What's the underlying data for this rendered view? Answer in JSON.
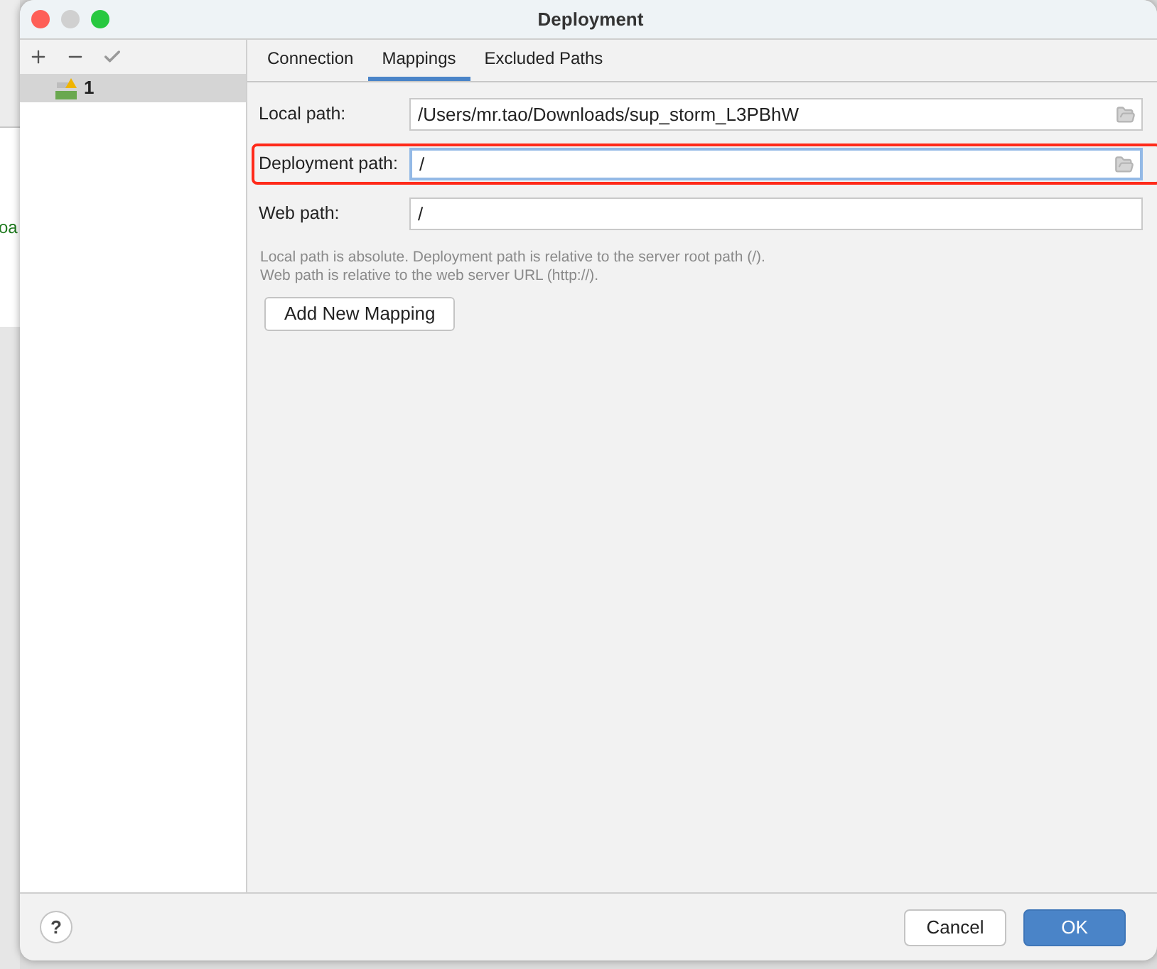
{
  "background": {
    "text": "oa"
  },
  "window": {
    "title": "Deployment"
  },
  "toolbar": [
    {
      "kind": "add",
      "disabled": false
    },
    {
      "kind": "remove",
      "disabled": false
    },
    {
      "kind": "check",
      "disabled": true
    }
  ],
  "servers": [
    {
      "name": "1",
      "selected": true,
      "warning": true
    }
  ],
  "tabs": [
    {
      "label": "Connection",
      "selected": false
    },
    {
      "label": "Mappings",
      "selected": true
    },
    {
      "label": "Excluded Paths",
      "selected": false
    }
  ],
  "fields": [
    {
      "label": "Local path:",
      "value": "/Users/mr.tao/Downloads/sup_storm_L3PBhW",
      "focused": false,
      "browse": true,
      "highlighted": false
    },
    {
      "label": "Deployment path:",
      "value": "/",
      "focused": true,
      "browse": true,
      "highlighted": true
    },
    {
      "label": "Web path:",
      "value": "/",
      "focused": false,
      "browse": false,
      "highlighted": false
    }
  ],
  "hint": [
    "Local path is absolute. Deployment path is relative to the server root path (/).",
    "Web path is relative to the web server URL (http://)."
  ],
  "add_button": "Add New Mapping",
  "help": "?",
  "buttons": [
    {
      "label": "Cancel",
      "primary": false
    },
    {
      "label": "OK",
      "primary": true
    }
  ]
}
